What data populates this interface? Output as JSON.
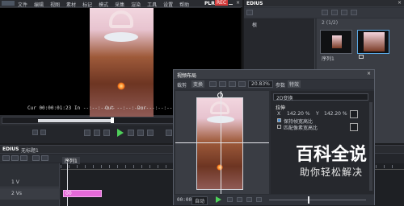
{
  "player": {
    "menu": [
      "文件",
      "编辑",
      "视图",
      "素材",
      "标记",
      "模式",
      "采集",
      "渲染",
      "工具",
      "设置",
      "帮助"
    ],
    "badge_plr": "PLR",
    "badge_rec": "REC",
    "cue_time": "Cur 00:00:01:23",
    "in_time": "In  --:--:--:--",
    "out_time": "Out --:--:--:--",
    "dur_time": "Dur --:--:--:--",
    "lower_row": "Cur 00:00:01:23   In --:--:--:--   Out --:--:--:--   Dur --:--:--:--"
  },
  "bin": {
    "title": "EDIUS",
    "path_label": "根",
    "count": "2 (1/2)",
    "clip_label": "序列1"
  },
  "timeline": {
    "title": "EDIUS",
    "seq_name": "无标题1",
    "tab": "序列1",
    "track_labels": [
      "1 V",
      "2 Vs"
    ],
    "clip_label": "00"
  },
  "dialog": {
    "title": "视频布局",
    "tabs": [
      "裁剪",
      "变换"
    ],
    "zoom": "20.83%",
    "params_tab": "参数",
    "effects_tab": "特效",
    "section": "2D变换",
    "group": "拉伸",
    "x_label": "X",
    "x_value": "142.20 %",
    "y_label": "Y",
    "y_value": "142.20 %",
    "keep_ratio": "保持帧宽高比",
    "pixel_ratio": "匹配像素宽高比",
    "time_label": "00:00",
    "loop_label": "自动"
  },
  "watermark": {
    "title": "百科全说",
    "subtitle": "助你轻松解决"
  },
  "colors": {
    "accent": "#5aa9e6",
    "clip_pink": "#e56ad8",
    "rec_red": "#d63b3b",
    "play_green": "#4fd05a"
  }
}
